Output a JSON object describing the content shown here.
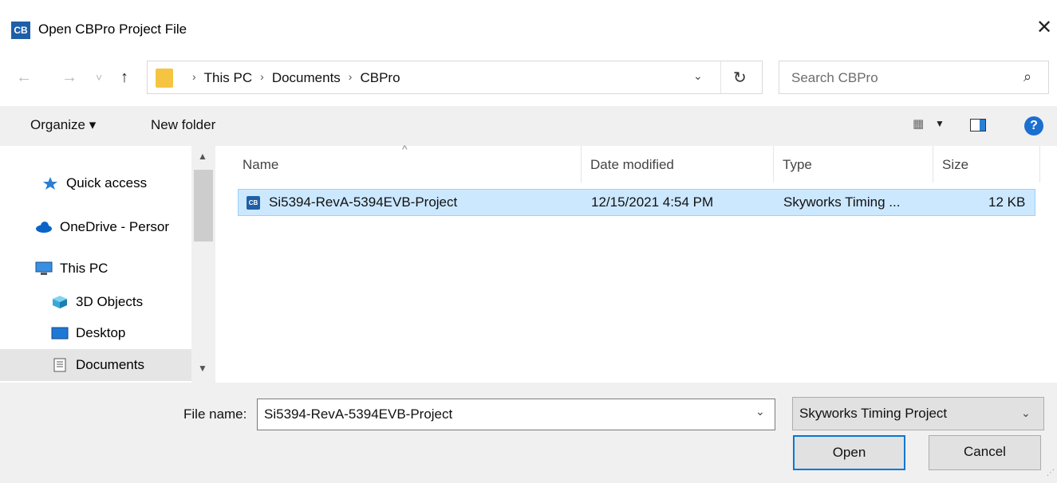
{
  "window": {
    "app_icon_text": "CB",
    "title": "Open CBPro Project File",
    "close_glyph": "✕"
  },
  "nav": {
    "back_icon": "←",
    "forward_icon": "→",
    "recent_icon": "˅",
    "up_icon": "↑"
  },
  "address": {
    "crumbs": [
      "This PC",
      "Documents",
      "CBPro"
    ],
    "separator": "›",
    "dropdown_glyph": "⌄",
    "refresh_glyph": "↻"
  },
  "search": {
    "placeholder": "Search CBPro",
    "icon": "⌕"
  },
  "toolbar": {
    "organize_label": "Organize ▾",
    "new_folder_label": "New folder",
    "view_icon": "▦",
    "view_caret": "▼",
    "help_glyph": "?"
  },
  "sidebar": {
    "items": [
      {
        "label": "Quick access",
        "icon": "star-icon"
      },
      {
        "label": "OneDrive - Persor",
        "icon": "cloud-icon"
      },
      {
        "label": "This PC",
        "icon": "computer-icon"
      },
      {
        "label": "3D Objects",
        "icon": "cube-icon"
      },
      {
        "label": "Desktop",
        "icon": "desktop-icon"
      },
      {
        "label": "Documents",
        "icon": "documents-icon",
        "selected": true
      }
    ],
    "scroll_up": "▲",
    "scroll_down": "▼"
  },
  "filelist": {
    "columns": [
      "Name",
      "Date modified",
      "Type",
      "Size"
    ],
    "sort_glyph": "^",
    "rows": [
      {
        "icon_text": "CB",
        "name": "Si5394-RevA-5394EVB-Project",
        "date_modified": "12/15/2021 4:54 PM",
        "type": "Skyworks Timing ...",
        "size": "12 KB",
        "selected": true
      }
    ]
  },
  "footer": {
    "file_name_label": "File name:",
    "file_name_value": "Si5394-RevA-5394EVB-Project",
    "file_name_caret": "⌄",
    "file_type_value": "Skyworks Timing Project",
    "file_type_caret": "⌄",
    "open_label": "Open",
    "cancel_label": "Cancel"
  },
  "colors": {
    "accent": "#0078d7",
    "selection_bg": "#cce8ff",
    "selection_border": "#99d1ff",
    "app_icon_bg": "#1f5fa8"
  }
}
